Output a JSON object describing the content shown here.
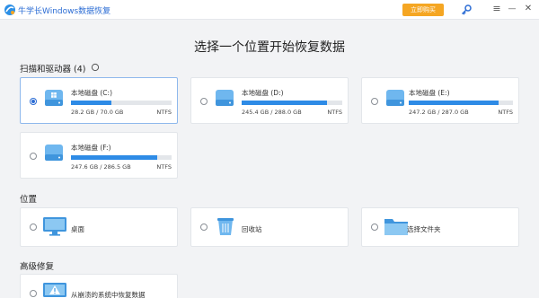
{
  "app": {
    "title": "牛学长Windows数据恢复",
    "buy_label": "立即购买",
    "menu_glyph": "≡",
    "minimize_glyph": "—",
    "close_glyph": "✕"
  },
  "main_title": "选择一个位置开始恢复数据",
  "drives_section": {
    "label": "扫描和驱动器 (4)",
    "drives": [
      {
        "name": "本地磁盘 (C:)",
        "size": "28.2 GB / 70.0 GB",
        "fs": "NTFS",
        "used_fraction": 0.4,
        "selected": true
      },
      {
        "name": "本地磁盘 (D:)",
        "size": "245.4 GB / 288.0 GB",
        "fs": "NTFS",
        "used_fraction": 0.85,
        "selected": false
      },
      {
        "name": "本地磁盘 (E:)",
        "size": "247.2 GB / 287.0 GB",
        "fs": "NTFS",
        "used_fraction": 0.86,
        "selected": false
      },
      {
        "name": "本地磁盘 (F:)",
        "size": "247.6 GB / 286.5 GB",
        "fs": "NTFS",
        "used_fraction": 0.86,
        "selected": false
      }
    ]
  },
  "location_section": {
    "label": "位置",
    "items": [
      {
        "label": "桌面",
        "icon": "monitor-icon"
      },
      {
        "label": "回收站",
        "icon": "recycle-bin-icon"
      },
      {
        "label": "选择文件夹",
        "icon": "folder-icon"
      }
    ]
  },
  "advanced_section": {
    "label": "高级修复",
    "items": [
      {
        "label": "从崩溃的系统中恢复数据",
        "icon": "warning-icon"
      }
    ]
  },
  "colors": {
    "accent": "#2b6cd4",
    "bar_fill": "#2e8be6",
    "buy_button": "#f5a623"
  }
}
